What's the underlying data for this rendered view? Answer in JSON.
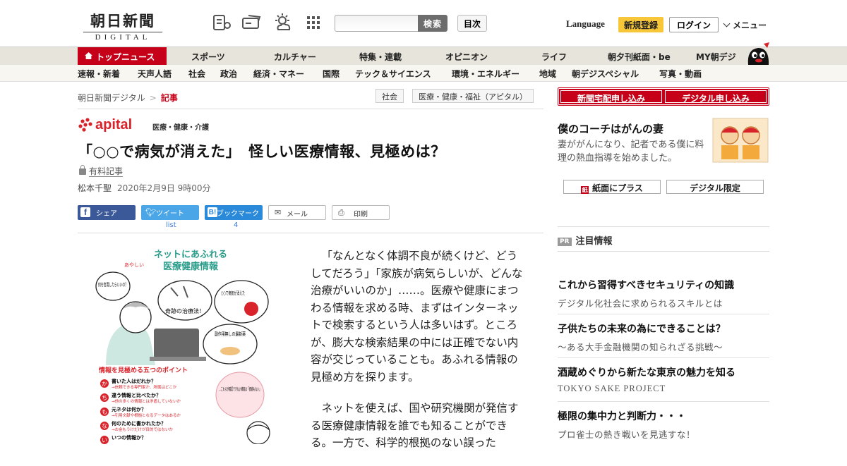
{
  "header": {
    "logo_main": "朝日新聞",
    "logo_sub": "DIGITAL",
    "icons": [
      "newspaper-icon",
      "ticket-icon",
      "weather-icon",
      "grid-menu-icon"
    ],
    "search_placeholder": "",
    "search_button": "検索",
    "index_button": "目次",
    "language": "Language",
    "register": "新規登録",
    "login": "ログイン",
    "menu": "メニュー"
  },
  "nav_primary": [
    "トップニュース",
    "スポーツ",
    "カルチャー",
    "特集・連載",
    "オピニオン",
    "ライフ",
    "朝夕刊紙面・be",
    "MY朝デジ"
  ],
  "nav_secondary": [
    "速報・新着",
    "天声人語",
    "社会",
    "政治",
    "経済・マネー",
    "国際",
    "テック＆サイエンス",
    "環境・エネルギー",
    "地域",
    "朝デジスペシャル",
    "写真・動画"
  ],
  "breadcrumb": {
    "home": "朝日新聞デジタル",
    "separator": ">",
    "current": "記事"
  },
  "tags": [
    "社会",
    "医療・健康・福祉（アピタル）"
  ],
  "article": {
    "brand": "apital",
    "brand_category": "医療・健康・介護",
    "headline": "「○○で病気が消えた」　怪しい医療情報、見極めは？",
    "paid_label": "有料記事",
    "author": "松本千聖",
    "date": "2020年2月9日 9時00分",
    "share": {
      "facebook": "シェア",
      "twitter": "ツイート",
      "twitter_count": "list",
      "hatena": "ブックマーク",
      "hatena_count": "4",
      "mail": "メール",
      "print": "印刷"
    },
    "illustration": {
      "title_small": "あやしい",
      "title_line1": "ネットにあふれる",
      "title_line2": "医療健康情報",
      "bubble_q": "何を信用したらいいの？",
      "bubble_cure": "奇跡の治療法！",
      "bubble_disappear": "○○で病気が消えた",
      "bubble_drug": "副作用無しの最新薬",
      "points_title": "情報を見極める五つのポイント",
      "points": [
        {
          "kana": "か",
          "q": "書いた人はだれか？",
          "a": "→信頼できる専門家か、所属はどこか"
        },
        {
          "kana": "ち",
          "q": "違う情報と比べたか？",
          "a": "→他の多くの情報とは矛盾していないか"
        },
        {
          "kana": "も",
          "q": "元ネタは何か？",
          "a": "→引用文献や根拠となるデータはあるか"
        },
        {
          "kana": "な",
          "q": "何のために書かれたか？",
          "a": "→お金もうけだけが目的ではないか"
        },
        {
          "kana": "い",
          "q": "いつの情報か？",
          "a": ""
        }
      ],
      "warning": "…これらが確認できない情報は「価値もない」"
    },
    "paragraphs": [
      "「なんとなく体調不良が続くけど、どうしてだろう」「家族が病気らしいが、どんな治療がいいのか」……。医療や健康にまつわる情報を求める時、まずはインターネットで検索するという人は多いはず。ところが、膨大な検索結果の中には正確でない内容が交じっていることも。あふれる情報の見極め方を探ります。",
      "ネットを使えば、国や研究機関が発信する医療健康情報を誰でも知ることができる。一方で、科学的根拠のない誤った"
    ]
  },
  "sidebar": {
    "subscribe_home": "新聞宅配申し込み",
    "subscribe_digital": "デジタル申し込み",
    "feature_title": "僕のコーチはがんの妻",
    "feature_desc": "妻ががんになり、記者である僕に料理の熱血指導を始めました。",
    "btn_plus": "紙面にプラス",
    "btn_digital_only": "デジタル限定",
    "pr_badge": "PR",
    "pr_heading": "注目情報",
    "ads": [
      {
        "title": "これから習得すべきセキュリティの知識",
        "sub": "デジタル化社会に求められるスキルとは"
      },
      {
        "title": "子供たちの未来の為にできることは？",
        "sub": "～ある大手金融機関の知られざる挑戦～"
      },
      {
        "title": "酒蔵めぐりから新たな東京の魅力を知る",
        "sub": "TOKYO SAKE PROJECT"
      },
      {
        "title": "極限の集中力と判断力・・・",
        "sub": "プロ雀士の熱き戦いを見逃すな！"
      }
    ]
  },
  "colors": {
    "brand_red": "#c50018",
    "apital_red": "#d8232a",
    "nav_bg": "#e7e4db",
    "register_yellow": "#f7c739"
  }
}
